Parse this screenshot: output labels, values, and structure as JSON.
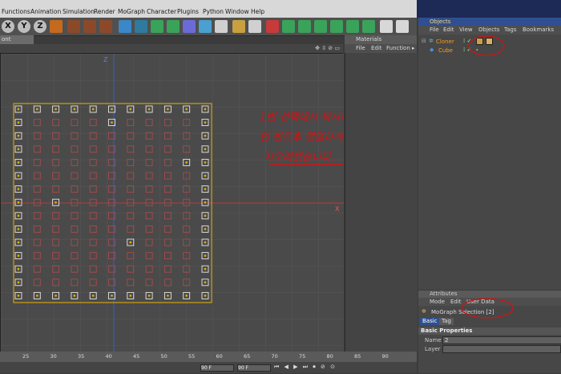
{
  "menubar": {
    "items": [
      "Functions",
      "Animation",
      "Simulation",
      "Render",
      "MoGraph",
      "Character",
      "Plugins",
      "Python",
      "Window",
      "Help"
    ]
  },
  "toolbar": {
    "axis_buttons": [
      "X",
      "Y",
      "Z"
    ]
  },
  "viewport": {
    "panel_title": "ont Browser",
    "axis_label_z": "Z",
    "axis_label_x": "X",
    "accent_color": "#e8b400",
    "annotation_lines": [
      "1번 선택해서 복사해서",
      "인 번트후 랜덤하게 몇개씩",
      "지우려했습니다."
    ]
  },
  "materials": {
    "title": "Materials",
    "menu": [
      "File",
      "Edit",
      "Function"
    ]
  },
  "objects": {
    "title": "Objects",
    "menu": [
      "File",
      "Edit",
      "View",
      "Objects",
      "Tags",
      "Bookmarks"
    ],
    "items": [
      {
        "name": "Cloner",
        "color": "#f0a020"
      },
      {
        "name": "Cube",
        "color": "#f0a020"
      }
    ]
  },
  "attributes": {
    "title": "Attributes",
    "menu": [
      "Mode",
      "Edit",
      "User Data"
    ],
    "selection_label": "MoGraph Selection [2]",
    "tabs": [
      "Basic",
      "Tag"
    ],
    "section": "Basic Properties",
    "name_label": "Name",
    "name_value": "2",
    "layer_label": "Layer"
  },
  "timeline": {
    "ticks": [
      "25",
      "30",
      "35",
      "40",
      "45",
      "50",
      "55",
      "60",
      "65",
      "70",
      "75",
      "80",
      "85",
      "90"
    ],
    "fields": [
      "90 F",
      "90 F"
    ]
  }
}
